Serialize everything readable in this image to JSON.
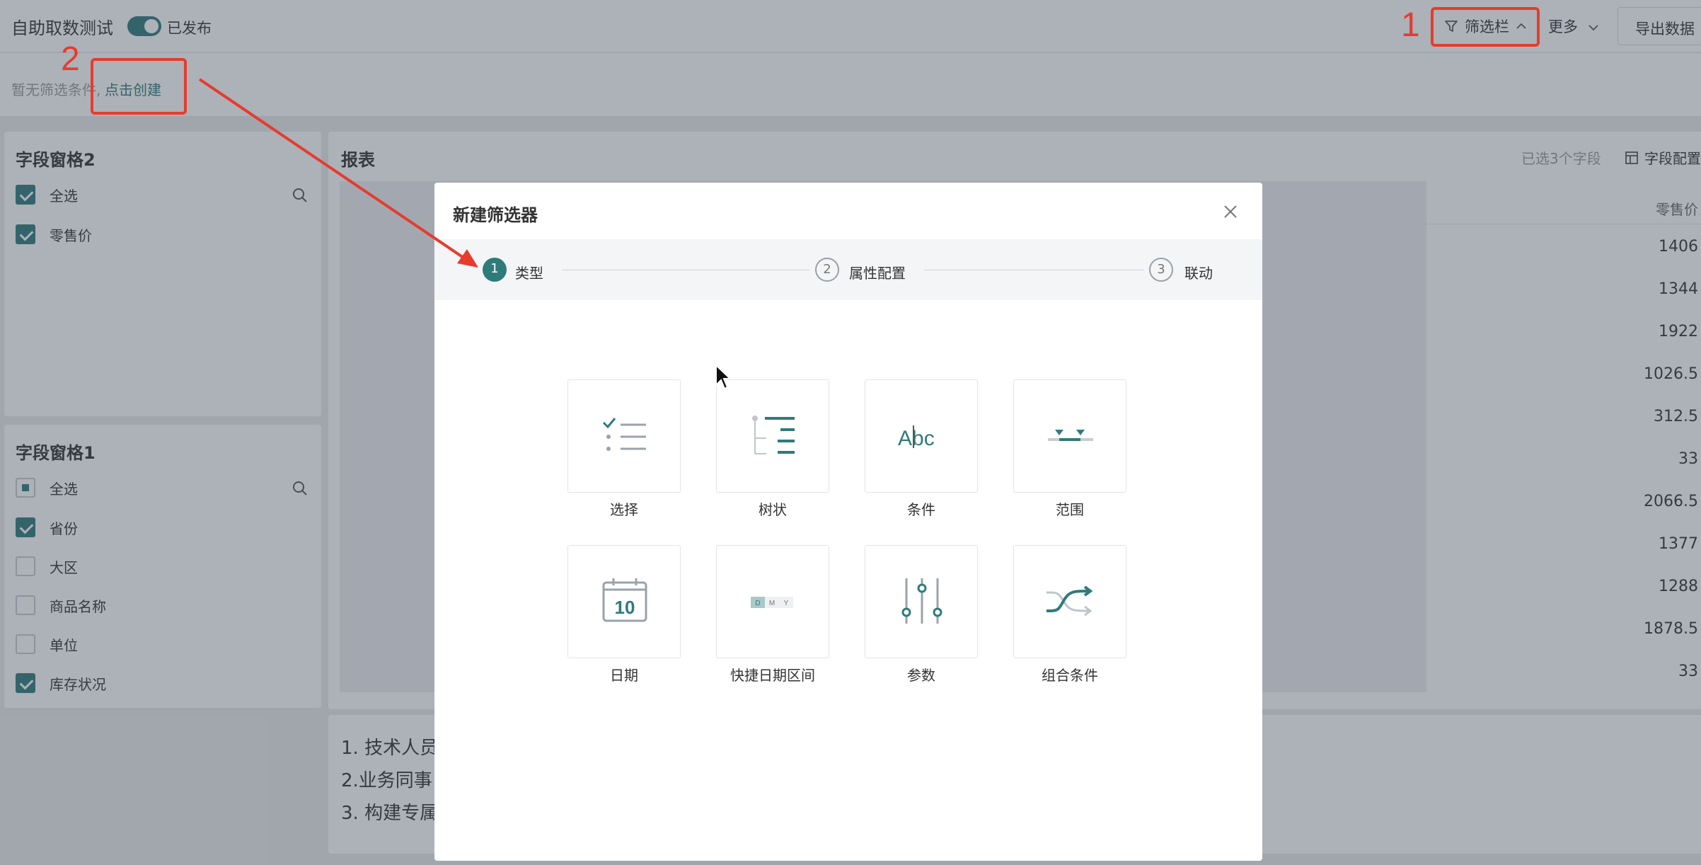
{
  "header": {
    "title": "自助取数测试",
    "publish_status": "已发布",
    "filter_bar_label": "筛选栏",
    "more_label": "更多",
    "export_label": "导出数据"
  },
  "filter_area": {
    "empty_text": "暂无筛选条件,",
    "create_link": "点击创建"
  },
  "field_panes": [
    {
      "title": "字段窗格2",
      "items": [
        {
          "label": "全选",
          "state": "checked"
        },
        {
          "label": "零售价",
          "state": "checked"
        }
      ]
    },
    {
      "title": "字段窗格1",
      "items": [
        {
          "label": "全选",
          "state": "partial"
        },
        {
          "label": "省份",
          "state": "checked"
        },
        {
          "label": "大区",
          "state": "unchecked"
        },
        {
          "label": "商品名称",
          "state": "unchecked"
        },
        {
          "label": "单位",
          "state": "unchecked"
        },
        {
          "label": "库存状况",
          "state": "checked"
        }
      ]
    }
  ],
  "report": {
    "title": "报表",
    "selected_count_text": "已选3个字段",
    "field_config_label": "字段配置",
    "column_header": "零售价",
    "values": [
      "1406",
      "1344",
      "1922",
      "1026.5",
      "312.5",
      "33",
      "2066.5",
      "1377",
      "1288",
      "1878.5",
      "33"
    ]
  },
  "notes": [
    "1. 技术人员",
    "2.业务同事",
    "3. 构建专属"
  ],
  "modal": {
    "title": "新建筛选器",
    "steps": [
      {
        "num": "1",
        "label": "类型",
        "active": true
      },
      {
        "num": "2",
        "label": "属性配置",
        "active": false
      },
      {
        "num": "3",
        "label": "联动",
        "active": false
      }
    ],
    "types": [
      {
        "label": "选择",
        "icon": "checklist-icon"
      },
      {
        "label": "树状",
        "icon": "tree-icon"
      },
      {
        "label": "条件",
        "icon": "text-condition-icon"
      },
      {
        "label": "范围",
        "icon": "range-icon"
      },
      {
        "label": "日期",
        "icon": "calendar-icon"
      },
      {
        "label": "快捷日期区间",
        "icon": "quick-date-icon"
      },
      {
        "label": "参数",
        "icon": "sliders-icon"
      },
      {
        "label": "组合条件",
        "icon": "shuffle-icon"
      }
    ],
    "calendar_day": "10",
    "quick_date_parts": [
      "D",
      "M",
      "Y"
    ],
    "condition_text": "Abc"
  },
  "annotations": {
    "label_1": "1",
    "label_2": "2",
    "accent_color": "#e53c2e"
  },
  "colors": {
    "primary": "#2f7b7a",
    "annotation": "#e53c2e"
  }
}
